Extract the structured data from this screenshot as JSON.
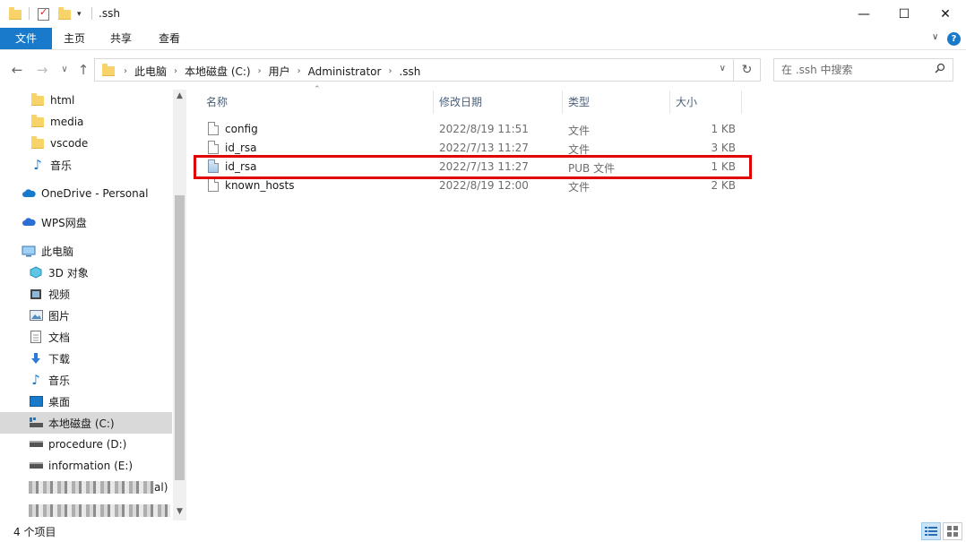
{
  "window": {
    "title": ".ssh"
  },
  "ribbon": {
    "tabs": [
      "文件",
      "主页",
      "共享",
      "查看"
    ]
  },
  "address": {
    "crumbs": [
      "此电脑",
      "本地磁盘 (C:)",
      "用户",
      "Administrator",
      ".ssh"
    ]
  },
  "search": {
    "placeholder": "在 .ssh 中搜索"
  },
  "navpane": {
    "quick_items": [
      {
        "label": "html",
        "icon": "folder-icon"
      },
      {
        "label": "media",
        "icon": "folder-icon"
      },
      {
        "label": "vscode",
        "icon": "folder-icon"
      },
      {
        "label": "音乐",
        "icon": "music-icon"
      }
    ],
    "onedrive": "OneDrive - Personal",
    "wps": "WPS网盘",
    "thispc": "此电脑",
    "pc_items": [
      {
        "label": "3D 对象",
        "icon": "3d-objects-icon"
      },
      {
        "label": "视频",
        "icon": "video-icon"
      },
      {
        "label": "图片",
        "icon": "pictures-icon"
      },
      {
        "label": "文档",
        "icon": "documents-icon"
      },
      {
        "label": "下载",
        "icon": "download-icon"
      },
      {
        "label": "音乐",
        "icon": "music-icon"
      },
      {
        "label": "桌面",
        "icon": "desktop-icon"
      },
      {
        "label": "本地磁盘 (C:)",
        "icon": "drive-c-icon"
      },
      {
        "label": "procedure (D:)",
        "icon": "drive-icon"
      },
      {
        "label": "information (E:)",
        "icon": "drive-icon"
      }
    ],
    "blurred_suffix": "al)"
  },
  "columns": {
    "name": "名称",
    "modified": "修改日期",
    "type": "类型",
    "size": "大小"
  },
  "files": [
    {
      "name": "config",
      "modified": "2022/8/19 11:51",
      "type": "文件",
      "size": "1 KB",
      "icon": "file-icon"
    },
    {
      "name": "id_rsa",
      "modified": "2022/7/13 11:27",
      "type": "文件",
      "size": "3 KB",
      "icon": "file-icon"
    },
    {
      "name": "id_rsa",
      "modified": "2022/7/13 11:27",
      "type": "PUB 文件",
      "size": "1 KB",
      "icon": "pub-file-icon"
    },
    {
      "name": "known_hosts",
      "modified": "2022/8/19 12:00",
      "type": "文件",
      "size": "2 KB",
      "icon": "file-icon"
    }
  ],
  "status": {
    "count": "4 个项目"
  },
  "colors": {
    "accent": "#1979ca",
    "highlight": "#e10000"
  }
}
